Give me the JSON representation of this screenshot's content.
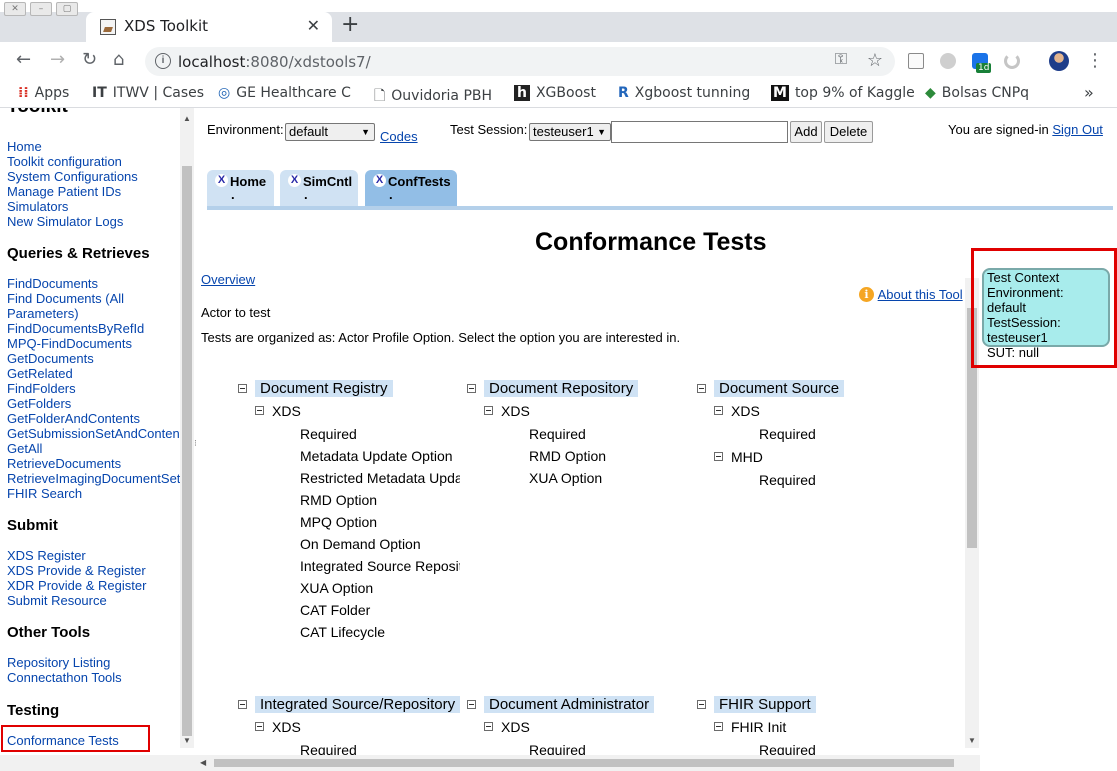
{
  "browser": {
    "tab_title": "XDS Toolkit",
    "url_host": "localhost",
    "url_rest": ":8080/xdstools7/",
    "ext_badge": "1d",
    "bookmarks": [
      {
        "label": "Apps",
        "icon": "apps-grid-icon"
      },
      {
        "label": "ITWV | Cases",
        "icon": "itwv-icon"
      },
      {
        "label": "GE Healthcare C",
        "icon": "ge-icon"
      },
      {
        "label": "Ouvidoria PBH",
        "icon": "page-icon"
      },
      {
        "label": "XGBoost",
        "icon": "h-icon"
      },
      {
        "label": "Xgboost tunning",
        "icon": "r-icon"
      },
      {
        "label": "top 9% of Kaggle",
        "icon": "m-icon"
      },
      {
        "label": "Bolsas CNPq",
        "icon": "flag-icon"
      }
    ]
  },
  "nav": {
    "title": "Toolkit",
    "general": [
      "Home",
      "Toolkit configuration",
      "System Configurations",
      "Manage Patient IDs",
      "Simulators",
      "New Simulator Logs"
    ],
    "queries_title": "Queries & Retrieves",
    "queries": [
      "FindDocuments",
      "Find Documents (All",
      "Parameters)",
      "FindDocumentsByRefId",
      "MPQ-FindDocuments",
      "GetDocuments",
      "GetRelated",
      "FindFolders",
      "GetFolders",
      "GetFolderAndContents",
      "GetSubmissionSetAndContents",
      "GetAll",
      "RetrieveDocuments",
      "RetrieveImagingDocumentSet",
      "FHIR Search"
    ],
    "submit_title": "Submit",
    "submit": [
      "XDS Register",
      "XDS Provide & Register",
      "XDR Provide & Register",
      "Submit Resource"
    ],
    "other_title": "Other Tools",
    "other": [
      "Repository Listing",
      "Connectathon Tools"
    ],
    "testing_title": "Testing",
    "testing": [
      "Conformance Tests"
    ]
  },
  "header": {
    "environment_label": "Environment:",
    "environment_value": "default",
    "codes_link": "Codes",
    "session_label": "Test Session:",
    "session_value": "testeuser1",
    "add_button": "Add",
    "delete_button": "Delete",
    "signed_in_text": "You are signed-in ",
    "sign_out_link": "Sign Out"
  },
  "tabs": [
    {
      "label": "Home",
      "close": "X",
      "dot": "."
    },
    {
      "label": "SimCntl",
      "close": "X",
      "dot": "."
    },
    {
      "label": "ConfTests",
      "close": "X",
      "dot": "."
    }
  ],
  "content": {
    "title": "Conformance Tests",
    "overview_link": "Overview",
    "about_link": "About this Tool",
    "actor_label": "Actor to test",
    "organization_text": "Tests are organized as: Actor Profile Option. Select the option you are interested in."
  },
  "actors": [
    {
      "name": "Document Registry",
      "profiles": [
        {
          "name": "XDS",
          "options": [
            "Required",
            "Metadata Update Option",
            "Restricted Metadata Update Option",
            "RMD Option",
            "MPQ Option",
            "On Demand Option",
            "Integrated Source Repository",
            "XUA Option",
            "CAT Folder",
            "CAT Lifecycle"
          ]
        }
      ]
    },
    {
      "name": "Document Repository",
      "profiles": [
        {
          "name": "XDS",
          "options": [
            "Required",
            "RMD Option",
            "XUA Option"
          ]
        }
      ]
    },
    {
      "name": "Document Source",
      "profiles": [
        {
          "name": "XDS",
          "options": [
            "Required"
          ]
        },
        {
          "name": "MHD",
          "options": [
            "Required"
          ]
        }
      ]
    },
    {
      "name": "Integrated Source/Repository",
      "profiles": [
        {
          "name": "XDS",
          "options": [
            "Required"
          ]
        }
      ]
    },
    {
      "name": "Document Administrator",
      "profiles": [
        {
          "name": "XDS",
          "options": [
            "Required"
          ]
        }
      ]
    },
    {
      "name": "FHIR Support",
      "profiles": [
        {
          "name": "FHIR Init",
          "options": [
            "Required"
          ]
        }
      ]
    }
  ],
  "test_context": {
    "title": "Test Context",
    "environment": "Environment: default",
    "session_label": "TestSession:",
    "session_value": "testeuser1",
    "sut": "SUT: null"
  },
  "colors": {
    "highlight_border": "#e00000",
    "tab_active": "#92bee6",
    "tab_inactive": "#d0e2f3",
    "context_bg": "#a8ecec",
    "link": "#0645ad"
  }
}
